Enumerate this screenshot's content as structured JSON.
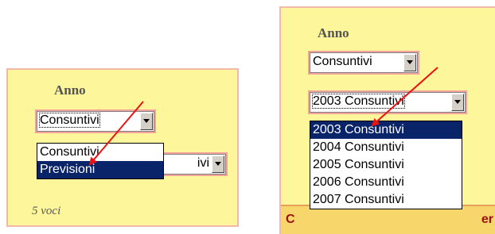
{
  "left_panel": {
    "heading": "Anno",
    "select_value": "Consuntivi",
    "dropdown_options": [
      "Consuntivi",
      "Previsioni"
    ],
    "selected_option_index": 1,
    "behind_select_partial": "ivi",
    "footer": "5 voci"
  },
  "right_panel": {
    "heading": "Anno",
    "select1_value": "Consuntivi",
    "select2_value": "2003 Consuntivi",
    "dropdown_options": [
      "2003 Consuntivi",
      "2004 Consuntivi",
      "2005 Consuntivi",
      "2006 Consuntivi",
      "2007 Consuntivi"
    ],
    "selected_option_index": 0,
    "strip_left": "C",
    "strip_right": "er"
  },
  "colors": {
    "panel_bg": "#fdf69b",
    "panel_border": "#f4b8a8",
    "select_highlight": "#f4a29c",
    "selection": "#0a246a",
    "annotation_arrow": "#ee1111"
  },
  "icons": [
    "chevron-down-icon",
    "red-arrow-annotation"
  ]
}
